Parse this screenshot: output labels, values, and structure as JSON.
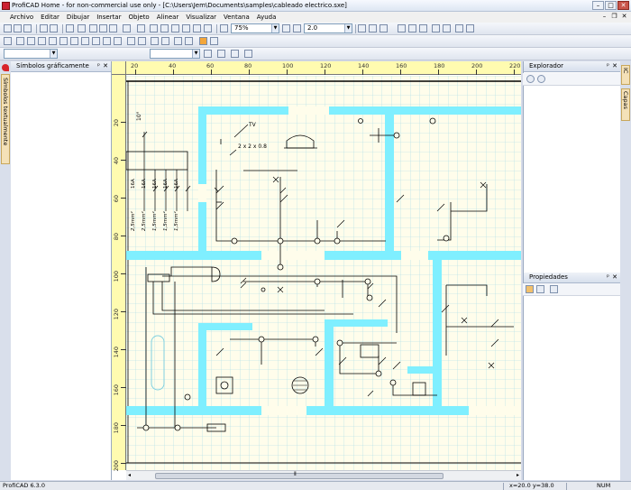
{
  "window": {
    "title": "ProfiCAD Home - for non-commercial use only - [C:\\Users\\Jem\\Documents\\samples\\cableado electrico.sxe]",
    "minimize": "–",
    "maximize": "□",
    "close": "✕"
  },
  "menu": {
    "items": [
      "Archivo",
      "Editar",
      "Dibujar",
      "Insertar",
      "Objeto",
      "Alinear",
      "Visualizar",
      "Ventana",
      "Ayuda"
    ],
    "mdi_min": "–",
    "mdi_restore": "❐",
    "mdi_close": "✕"
  },
  "toolbar": {
    "zoom_value": "75%",
    "line_width_value": "2.0"
  },
  "left_panel": {
    "title": "Símbolos gráficamente",
    "pin": "ᵖ",
    "close": "✕",
    "side_tab": "Símbolos textualmente"
  },
  "explorer": {
    "title": "Explorador",
    "pin": "ᵖ",
    "close": "✕"
  },
  "properties": {
    "title": "Propiedades",
    "pin": "ᵖ",
    "close": "✕"
  },
  "right_tabs": {
    "ic": "IC",
    "layers": "Capas"
  },
  "ruler": {
    "h_ticks": [
      "20",
      "40",
      "60",
      "80",
      "100",
      "120",
      "140",
      "160",
      "180",
      "200",
      "220"
    ],
    "v_ticks": [
      "20",
      "40",
      "60",
      "80",
      "100",
      "120",
      "140",
      "160",
      "180",
      "200"
    ]
  },
  "drawing": {
    "tv_label": "TV",
    "cable_label": "2 x 2 x 0.8",
    "angle_label": "10°",
    "fuse_ratings": [
      "16A",
      "16A",
      "16A",
      "16A",
      "16A"
    ],
    "wire_sections": [
      "2,5mm²",
      "2,5mm²",
      "1,5mm²",
      "1,5mm²",
      "1,5mm²"
    ]
  },
  "status": {
    "version": "ProfiCAD 6.3.0",
    "coords": "x=20.0  y=38.0",
    "num": "NUM"
  },
  "colors": {
    "walls": "#7fefff",
    "grid": "#a6dce8",
    "paper": "#fffdeb",
    "ruler": "#fffbb0"
  }
}
